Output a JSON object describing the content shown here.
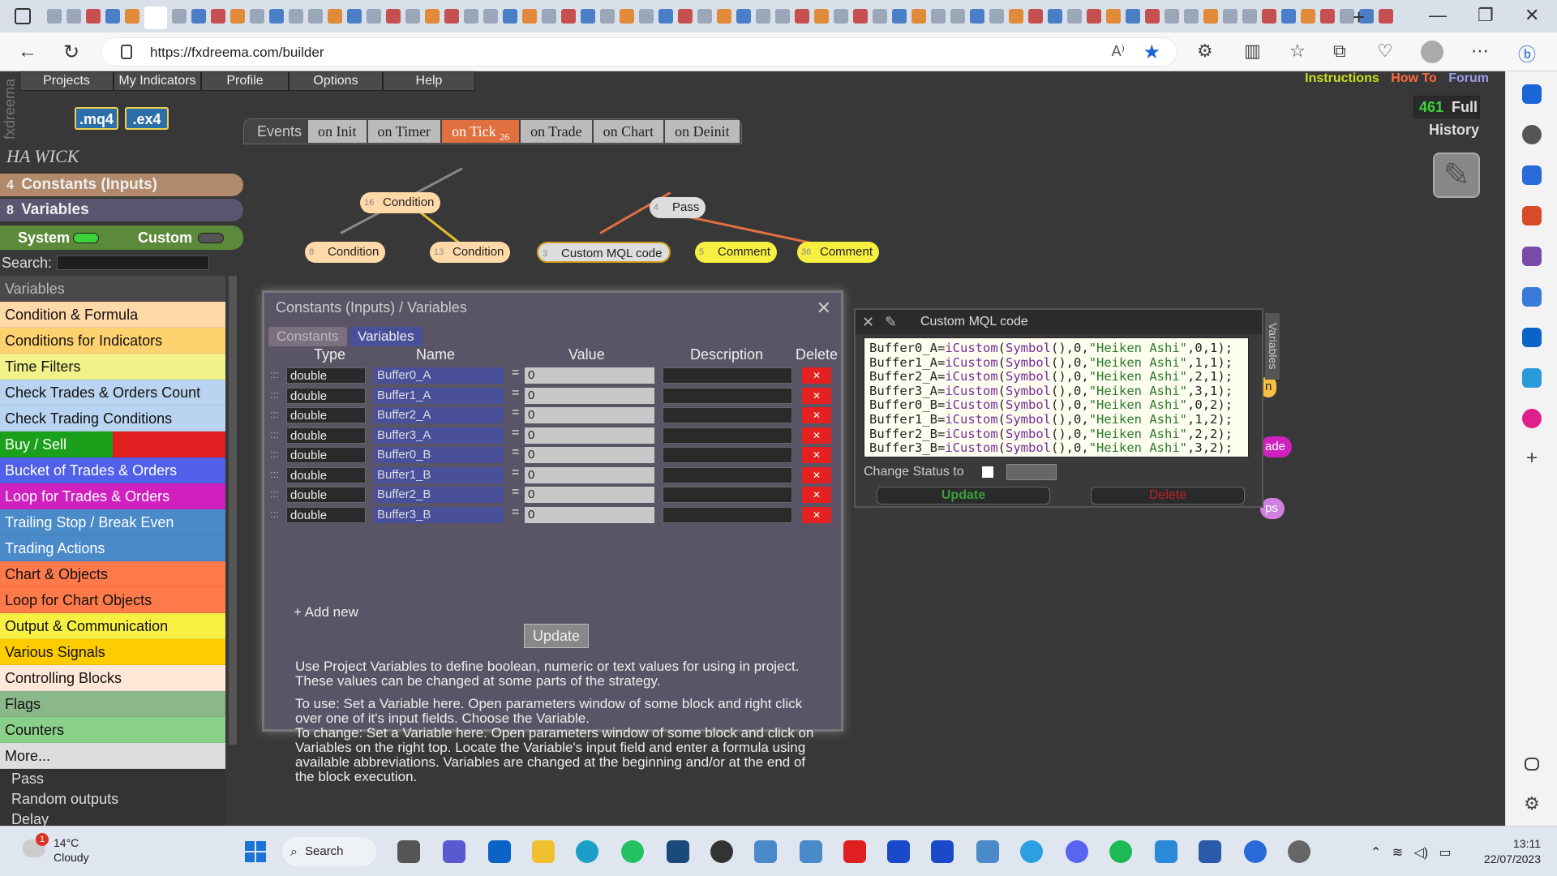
{
  "browser": {
    "url": "https://fxdreema.com/builder",
    "read_aloud": "A⁾"
  },
  "app": {
    "logo": "fxdreema",
    "menu": [
      "Projects",
      "My Indicators",
      "Profile",
      "Options",
      "Help"
    ],
    "links": {
      "instructions": "Instructions",
      "howto": "How To",
      "forum": "Forum"
    },
    "mq4": ".mq4",
    "ex4": ".ex4",
    "counter_num": "461",
    "counter_label": "Full",
    "history": "History",
    "events_label": "Events",
    "events_tabs": [
      "on Init",
      "on Timer",
      "on Tick",
      "on Trade",
      "on Chart",
      "on Deinit"
    ],
    "on_tick_count": "26",
    "project_title": "HA WICK",
    "constants_num": "4",
    "constants_label": "Constants (Inputs)",
    "variables_num": "8",
    "variables_label": "Variables",
    "system_label": "System",
    "custom_label": "Custom",
    "search_label": "Search:",
    "categories_header": "Variables",
    "categories": [
      {
        "label": "Condition & Formula",
        "color": "#ffd9a8"
      },
      {
        "label": "Conditions for Indicators",
        "color": "#ffd270"
      },
      {
        "label": "Time Filters",
        "color": "#f2f28a"
      },
      {
        "label": "Check Trades & Orders Count",
        "color": "#b8d4f0"
      },
      {
        "label": "Check Trading Conditions",
        "color": "#b8d4f0"
      },
      {
        "label": "Buy / Sell",
        "color": "#e02020"
      },
      {
        "label": "Bucket of Trades & Orders",
        "color": "#5060e8"
      },
      {
        "label": "Loop for Trades & Orders",
        "color": "#d020c0"
      },
      {
        "label": "Trailing Stop / Break Even",
        "color": "#4a8ac8"
      },
      {
        "label": "Trading Actions",
        "color": "#4a8ac8"
      },
      {
        "label": "Chart & Objects",
        "color": "#ff7a4a"
      },
      {
        "label": "Loop for Chart Objects",
        "color": "#ff7a4a"
      },
      {
        "label": "Output & Communication",
        "color": "#f8f040"
      },
      {
        "label": "Various Signals",
        "color": "#ffcc00"
      },
      {
        "label": "Controlling Blocks",
        "color": "#ffe8d8"
      },
      {
        "label": "Flags",
        "color": "#8ab88a"
      },
      {
        "label": "Counters",
        "color": "#8ad08a"
      },
      {
        "label": "More...",
        "color": "#dddddd"
      }
    ],
    "sub_items": [
      "Pass",
      "Random outputs",
      "Delay"
    ]
  },
  "graph": {
    "nodes": [
      {
        "id": "16",
        "label": "Condition"
      },
      {
        "id": "4",
        "label": "Pass"
      },
      {
        "id": "8",
        "label": "Condition"
      },
      {
        "id": "13",
        "label": "Condition"
      },
      {
        "id": "3",
        "label": "Custom MQL code"
      },
      {
        "id": "5",
        "label": "Comment"
      },
      {
        "id": "36",
        "label": "Comment"
      }
    ],
    "partial_labels": [
      "n",
      "ade",
      "ps"
    ]
  },
  "var_dialog": {
    "title": "Constants (Inputs) / Variables",
    "tab_constants": "Constants",
    "tab_variables": "Variables",
    "headers": {
      "type": "Type",
      "name": "Name",
      "value": "Value",
      "description": "Description",
      "delete": "Delete"
    },
    "rows": [
      {
        "type": "double",
        "name": "Buffer0_A",
        "value": "0"
      },
      {
        "type": "double",
        "name": "Buffer1_A",
        "value": "0"
      },
      {
        "type": "double",
        "name": "Buffer2_A",
        "value": "0"
      },
      {
        "type": "double",
        "name": "Buffer3_A",
        "value": "0"
      },
      {
        "type": "double",
        "name": "Buffer0_B",
        "value": "0"
      },
      {
        "type": "double",
        "name": "Buffer1_B",
        "value": "0"
      },
      {
        "type": "double",
        "name": "Buffer2_B",
        "value": "0"
      },
      {
        "type": "double",
        "name": "Buffer3_B",
        "value": "0"
      }
    ],
    "add_new": "+ Add new",
    "update": "Update",
    "help": [
      "Use Project Variables to define boolean, numeric or text values for using in project. These values can be changed at some parts of the strategy.",
      "To use: Set a Variable here. Open parameters window of some block and right click over one of it's input fields. Choose the Variable.",
      "To change: Set a Variable here. Open parameters window of some block and click on Variables on the right top. Locate the Variable's input field and enter a formula using available abbreviations. Variables are changed at the beginning and/or at the end of the block execution."
    ]
  },
  "mql_dialog": {
    "title": "Custom MQL code",
    "code_lines": [
      {
        "var": "Buffer0_A",
        "buf": "0",
        "shift": "1"
      },
      {
        "var": "Buffer1_A",
        "buf": "1",
        "shift": "1"
      },
      {
        "var": "Buffer2_A",
        "buf": "2",
        "shift": "1"
      },
      {
        "var": "Buffer3_A",
        "buf": "3",
        "shift": "1"
      },
      {
        "var": "Buffer0_B",
        "buf": "0",
        "shift": "2"
      },
      {
        "var": "Buffer1_B",
        "buf": "1",
        "shift": "2"
      },
      {
        "var": "Buffer2_B",
        "buf": "2",
        "shift": "2"
      },
      {
        "var": "Buffer3_B",
        "buf": "3",
        "shift": "2"
      }
    ],
    "change_status": "Change Status to",
    "update": "Update",
    "delete": "Delete",
    "side_tab": "Variables"
  },
  "taskbar": {
    "temp": "14°C",
    "condition": "Cloudy",
    "weather_badge": "1",
    "search": "Search",
    "time": "13:11",
    "date": "22/07/2023"
  }
}
